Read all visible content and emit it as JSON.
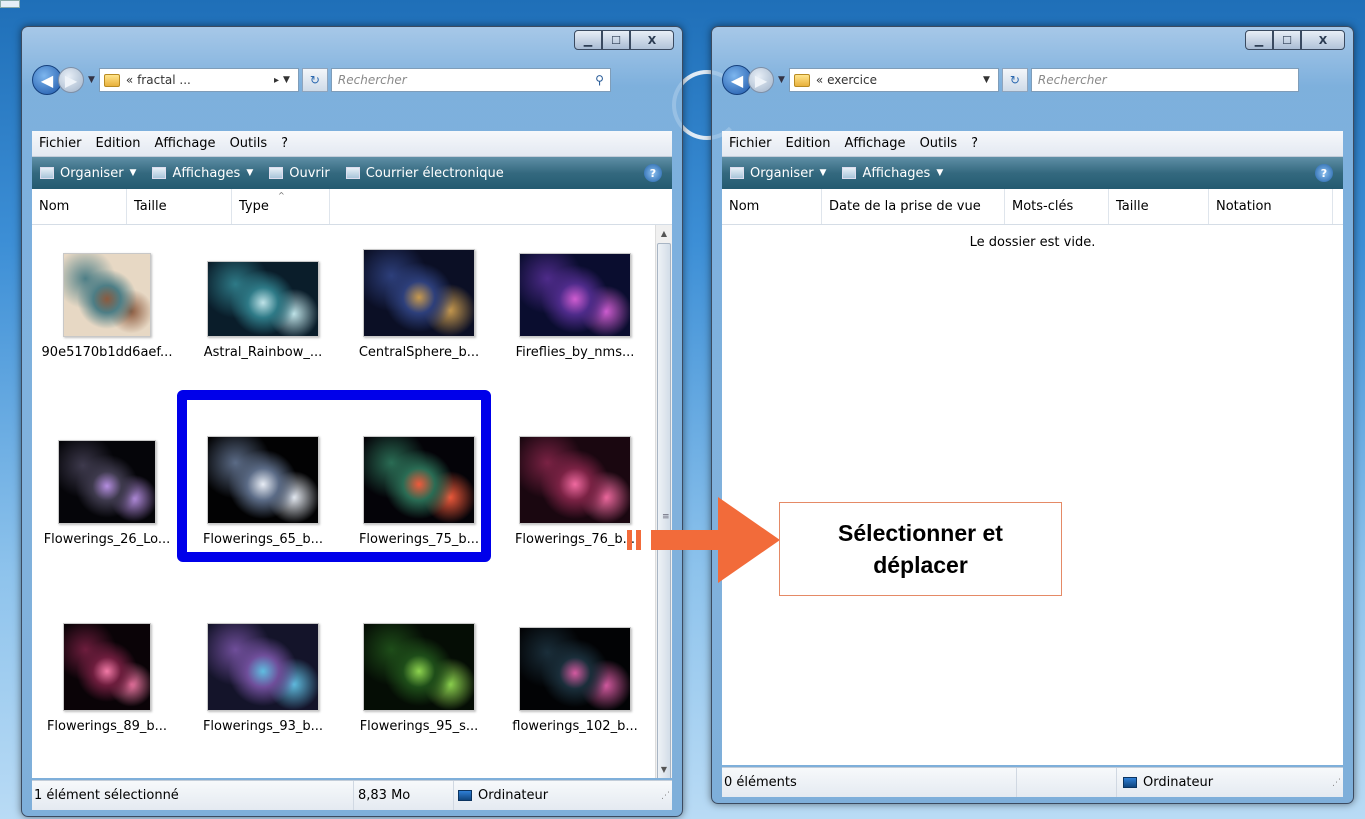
{
  "left_window": {
    "address": "« fractal ...",
    "search_placeholder": "Rechercher",
    "menu": [
      "Fichier",
      "Edition",
      "Affichage",
      "Outils",
      "?"
    ],
    "toolbar": {
      "organize": "Organiser",
      "views": "Affichages",
      "open": "Ouvrir",
      "email": "Courrier électronique"
    },
    "columns": [
      "Nom",
      "Taille",
      "Type"
    ],
    "files": [
      {
        "name": "90e5170b1dd6aef...",
        "colors": [
          "#e7d8c4",
          "#4d7e86",
          "#8c5a3e"
        ]
      },
      {
        "name": "Astral_Rainbow_...",
        "colors": [
          "#0a1d2a",
          "#2e7a87",
          "#bfe3e8"
        ]
      },
      {
        "name": "CentralSphere_b...",
        "colors": [
          "#0b0f25",
          "#2d3f7b",
          "#c89a4e"
        ]
      },
      {
        "name": "Fireflies_by_nms...",
        "colors": [
          "#0a0d2f",
          "#4e2b8a",
          "#d05dd1"
        ]
      },
      {
        "name": "Flowerings_26_Lo...",
        "colors": [
          "#050509",
          "#3e3a4d",
          "#b58ee0"
        ]
      },
      {
        "name": "Flowerings_65_b...",
        "colors": [
          "#020203",
          "#5b6b86",
          "#e8edf5"
        ]
      },
      {
        "name": "Flowerings_75_b...",
        "colors": [
          "#040308",
          "#2a6c54",
          "#f05a3b"
        ]
      },
      {
        "name": "Flowerings_76_b...",
        "colors": [
          "#1a0710",
          "#7a2244",
          "#f06aa0"
        ]
      },
      {
        "name": "Flowerings_89_b...",
        "colors": [
          "#0a0307",
          "#6d1d3d",
          "#f27aa7"
        ]
      },
      {
        "name": "Flowerings_93_b...",
        "colors": [
          "#14142a",
          "#6f4e9a",
          "#5fbde0"
        ]
      },
      {
        "name": "Flowerings_95_s...",
        "colors": [
          "#050d05",
          "#1e4d19",
          "#8ed44f"
        ]
      },
      {
        "name": "flowerings_102_b...",
        "colors": [
          "#020305",
          "#1a2e3a",
          "#d45aa0"
        ]
      }
    ],
    "status": {
      "selection": "1 élément sélectionné",
      "size": "8,83 Mo",
      "location": "Ordinateur"
    }
  },
  "right_window": {
    "address": "« exercice",
    "search_placeholder": "Rechercher",
    "menu": [
      "Fichier",
      "Edition",
      "Affichage",
      "Outils",
      "?"
    ],
    "toolbar": {
      "organize": "Organiser",
      "views": "Affichages"
    },
    "columns": [
      "Nom",
      "Date de la prise de vue",
      "Mots-clés",
      "Taille",
      "Notation"
    ],
    "empty_message": "Le dossier est vide.",
    "status": {
      "count": "0 éléments",
      "location": "Ordinateur"
    }
  },
  "annotation": {
    "callout_line1": "Sélectionner et",
    "callout_line2": "déplacer",
    "highlight_color": "#0000ea",
    "arrow_color": "#f26b3a"
  }
}
